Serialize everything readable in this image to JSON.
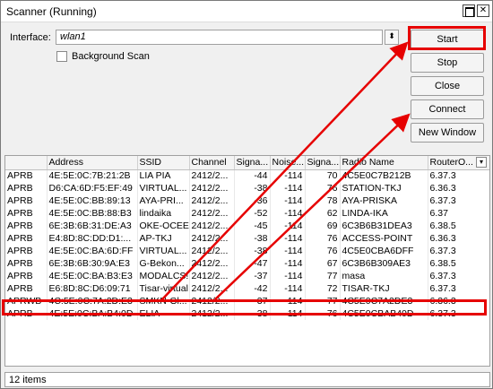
{
  "window": {
    "title": "Scanner (Running)",
    "max_glyph": "",
    "close_glyph": "✕"
  },
  "interface": {
    "label": "Interface:",
    "value": "wlan1",
    "dropdown_glyph": "⬍"
  },
  "background_scan": {
    "label": "Background Scan",
    "checked": false
  },
  "buttons": {
    "start": "Start",
    "stop": "Stop",
    "close": "Close",
    "connect": "Connect",
    "new_window": "New Window"
  },
  "table": {
    "columns": [
      "",
      "Address",
      "SSID",
      "Channel",
      "Signa...",
      "Noise...",
      "Signa...",
      "Radio Name",
      "RouterO..."
    ],
    "menu_glyph": "▾",
    "rows": [
      [
        "APRB",
        "4E:5E:0C:7B:21:2B",
        "LIA PIA",
        "2412/2...",
        "-44",
        "-114",
        "70",
        "4C5E0C7B212B",
        "6.37.3"
      ],
      [
        "APRB",
        "D6:CA:6D:F5:EF:49",
        "VIRTUAL...",
        "2412/2...",
        "-38",
        "-114",
        "76",
        "STATION-TKJ",
        "6.36.3"
      ],
      [
        "APRB",
        "4E:5E:0C:BB:89:13",
        "AYA-PRI...",
        "2412/2...",
        "-36",
        "-114",
        "78",
        "AYA-PRISKA",
        "6.37.3"
      ],
      [
        "APRB",
        "4E:5E:0C:BB:88:B3",
        "lindaika",
        "2412/2...",
        "-52",
        "-114",
        "62",
        "LINDA-IKA",
        "6.37"
      ],
      [
        "APRB",
        "6E:3B:6B:31:DE:A3",
        "OKE-OCEE",
        "2412/2...",
        "-45",
        "-114",
        "69",
        "6C3B6B31DEA3",
        "6.38.5"
      ],
      [
        "APRB",
        "E4:8D:8C:DD:D1:...",
        "AP-TKJ",
        "2412/2...",
        "-38",
        "-114",
        "76",
        "ACCESS-POINT",
        "6.36.3"
      ],
      [
        "APRB",
        "4E:5E:0C:BA:6D:FF",
        "VIRTUAL...",
        "2412/2...",
        "-38",
        "-114",
        "76",
        "4C5E0CBA6DFF",
        "6.37.3"
      ],
      [
        "APRB",
        "6E:3B:6B:30:9A:E3",
        "G-Bekon...",
        "2412/2...",
        "-47",
        "-114",
        "67",
        "6C3B6B309AE3",
        "6.38.5"
      ],
      [
        "APRB",
        "4E:5E:0C:BA:B3:E3",
        "MODALCS!",
        "2412/2...",
        "-37",
        "-114",
        "77",
        "masa",
        "6.37.3"
      ],
      [
        "APRB",
        "E6:8D:8C:D6:09:71",
        "Tisar-virtual",
        "2412/2...",
        "-42",
        "-114",
        "72",
        "TISAR-TKJ",
        "6.37.3"
      ],
      [
        "APRWB",
        "4C:5E:0C:7A:2D:E3",
        "SMKN-Gl...",
        "2412/2...",
        "-37",
        "-114",
        "77",
        "4C5E0C7A2DE3",
        "6.36.3"
      ],
      [
        "APRB",
        "4E:5E:0C:BA:B4:0D",
        "ELIA",
        "2412/2...",
        "-38",
        "-114",
        "76",
        "4C5E0CBAB40D",
        "6.37.3"
      ]
    ],
    "highlighted_row": 10
  },
  "status": {
    "items_text": "12 items"
  },
  "annotation_color": "#e60000"
}
